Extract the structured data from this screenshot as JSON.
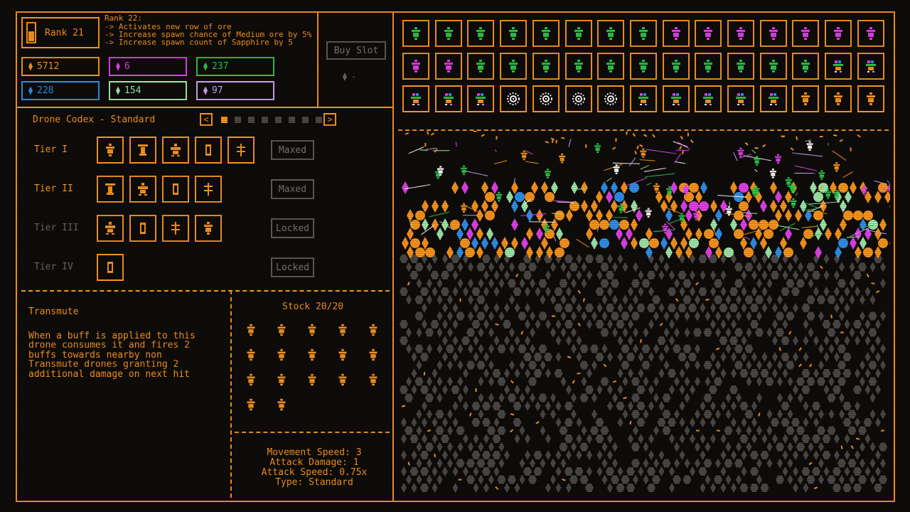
{
  "rank": {
    "label": "Rank 21",
    "info_title": "Rank 22:",
    "info_lines": [
      "-> Activates new row of ore",
      "-> Increase spawn chance of Medium ore by 5%",
      "-> Increase spawn count of Sapphire by 5"
    ]
  },
  "resources": [
    {
      "value": "5712",
      "color": "#f7941d"
    },
    {
      "value": "6",
      "color": "#e040e8"
    },
    {
      "value": "237",
      "color": "#2ec24a"
    },
    {
      "value": "228",
      "color": "#2f8fe8"
    },
    {
      "value": "154",
      "color": "#9ee6a8"
    },
    {
      "value": "97",
      "color": "#c9a4f2"
    }
  ],
  "buy_slot": {
    "label": "Buy Slot",
    "cost_text": "-"
  },
  "codex": {
    "title": "Drone Codex - Standard",
    "prev_icon": "chevron-left-icon",
    "next_icon": "chevron-right-icon",
    "page_dots": 8,
    "active_page": 1,
    "tiers": [
      {
        "label": "Tier I",
        "count": 5,
        "status": "Maxed",
        "enabled": true
      },
      {
        "label": "Tier II",
        "count": 4,
        "status": "Maxed",
        "enabled": true
      },
      {
        "label": "Tier III",
        "count": 4,
        "status": "Locked",
        "enabled": false
      },
      {
        "label": "Tier IV",
        "count": 1,
        "status": "Locked",
        "enabled": false
      }
    ]
  },
  "ability": {
    "name": "Transmute",
    "description": [
      "When a buff is applied to this",
      "drone consumes it and fires 2",
      "buffs towards nearby non",
      "Transmute drones granting 2",
      "additional damage on next hit"
    ]
  },
  "stock": {
    "label": "Stock 20/20",
    "count": 17
  },
  "stats": [
    "Movement Speed: 3",
    "Attack Damage: 1",
    "Attack Speed: 0.75x",
    "Type: Standard"
  ],
  "slot_grid": {
    "rows": [
      [
        "green",
        "green",
        "green",
        "green",
        "green",
        "green",
        "green",
        "green",
        "magenta",
        "magenta",
        "magenta",
        "magenta",
        "magenta",
        "magenta",
        "magenta"
      ],
      [
        "magenta",
        "magenta",
        "green",
        "green",
        "green",
        "green",
        "green",
        "green",
        "green",
        "green",
        "green",
        "green",
        "green",
        "multi",
        "multi"
      ],
      [
        "multi",
        "multi",
        "multi",
        "white",
        "white",
        "white",
        "white",
        "multi",
        "multi",
        "multi",
        "multi",
        "multi",
        "orange",
        "orange",
        "orange"
      ]
    ]
  },
  "colors": {
    "accent": "#f7941d",
    "disabled": "#5e5a56",
    "ore_grey": "#4a4744",
    "background": "#0e0c0a"
  }
}
